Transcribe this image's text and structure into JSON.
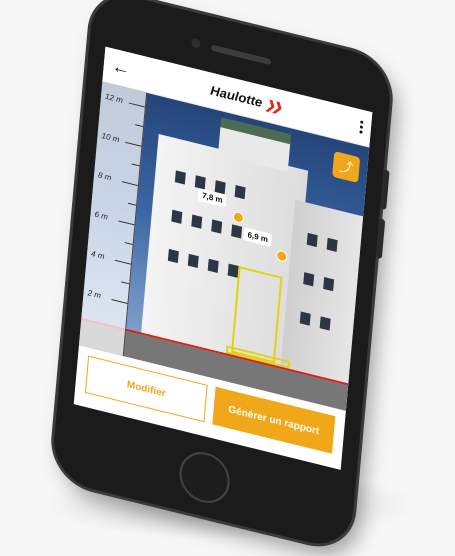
{
  "app": {
    "brand": "Haulotte",
    "back_icon": "arrow-left-icon",
    "menu_icon": "more-vertical-icon"
  },
  "measure": {
    "ruler_labels": [
      "12 m",
      "10 m",
      "8 m",
      "6 m",
      "4 m",
      "2 m"
    ],
    "height_tags": [
      "7,8 m",
      "6,9 m"
    ],
    "share_icon": "share-icon"
  },
  "actions": {
    "modify_label": "Modifier",
    "report_label": "Générer un rapport"
  },
  "colors": {
    "accent": "#f0a719",
    "brand_red": "#e1261c"
  }
}
